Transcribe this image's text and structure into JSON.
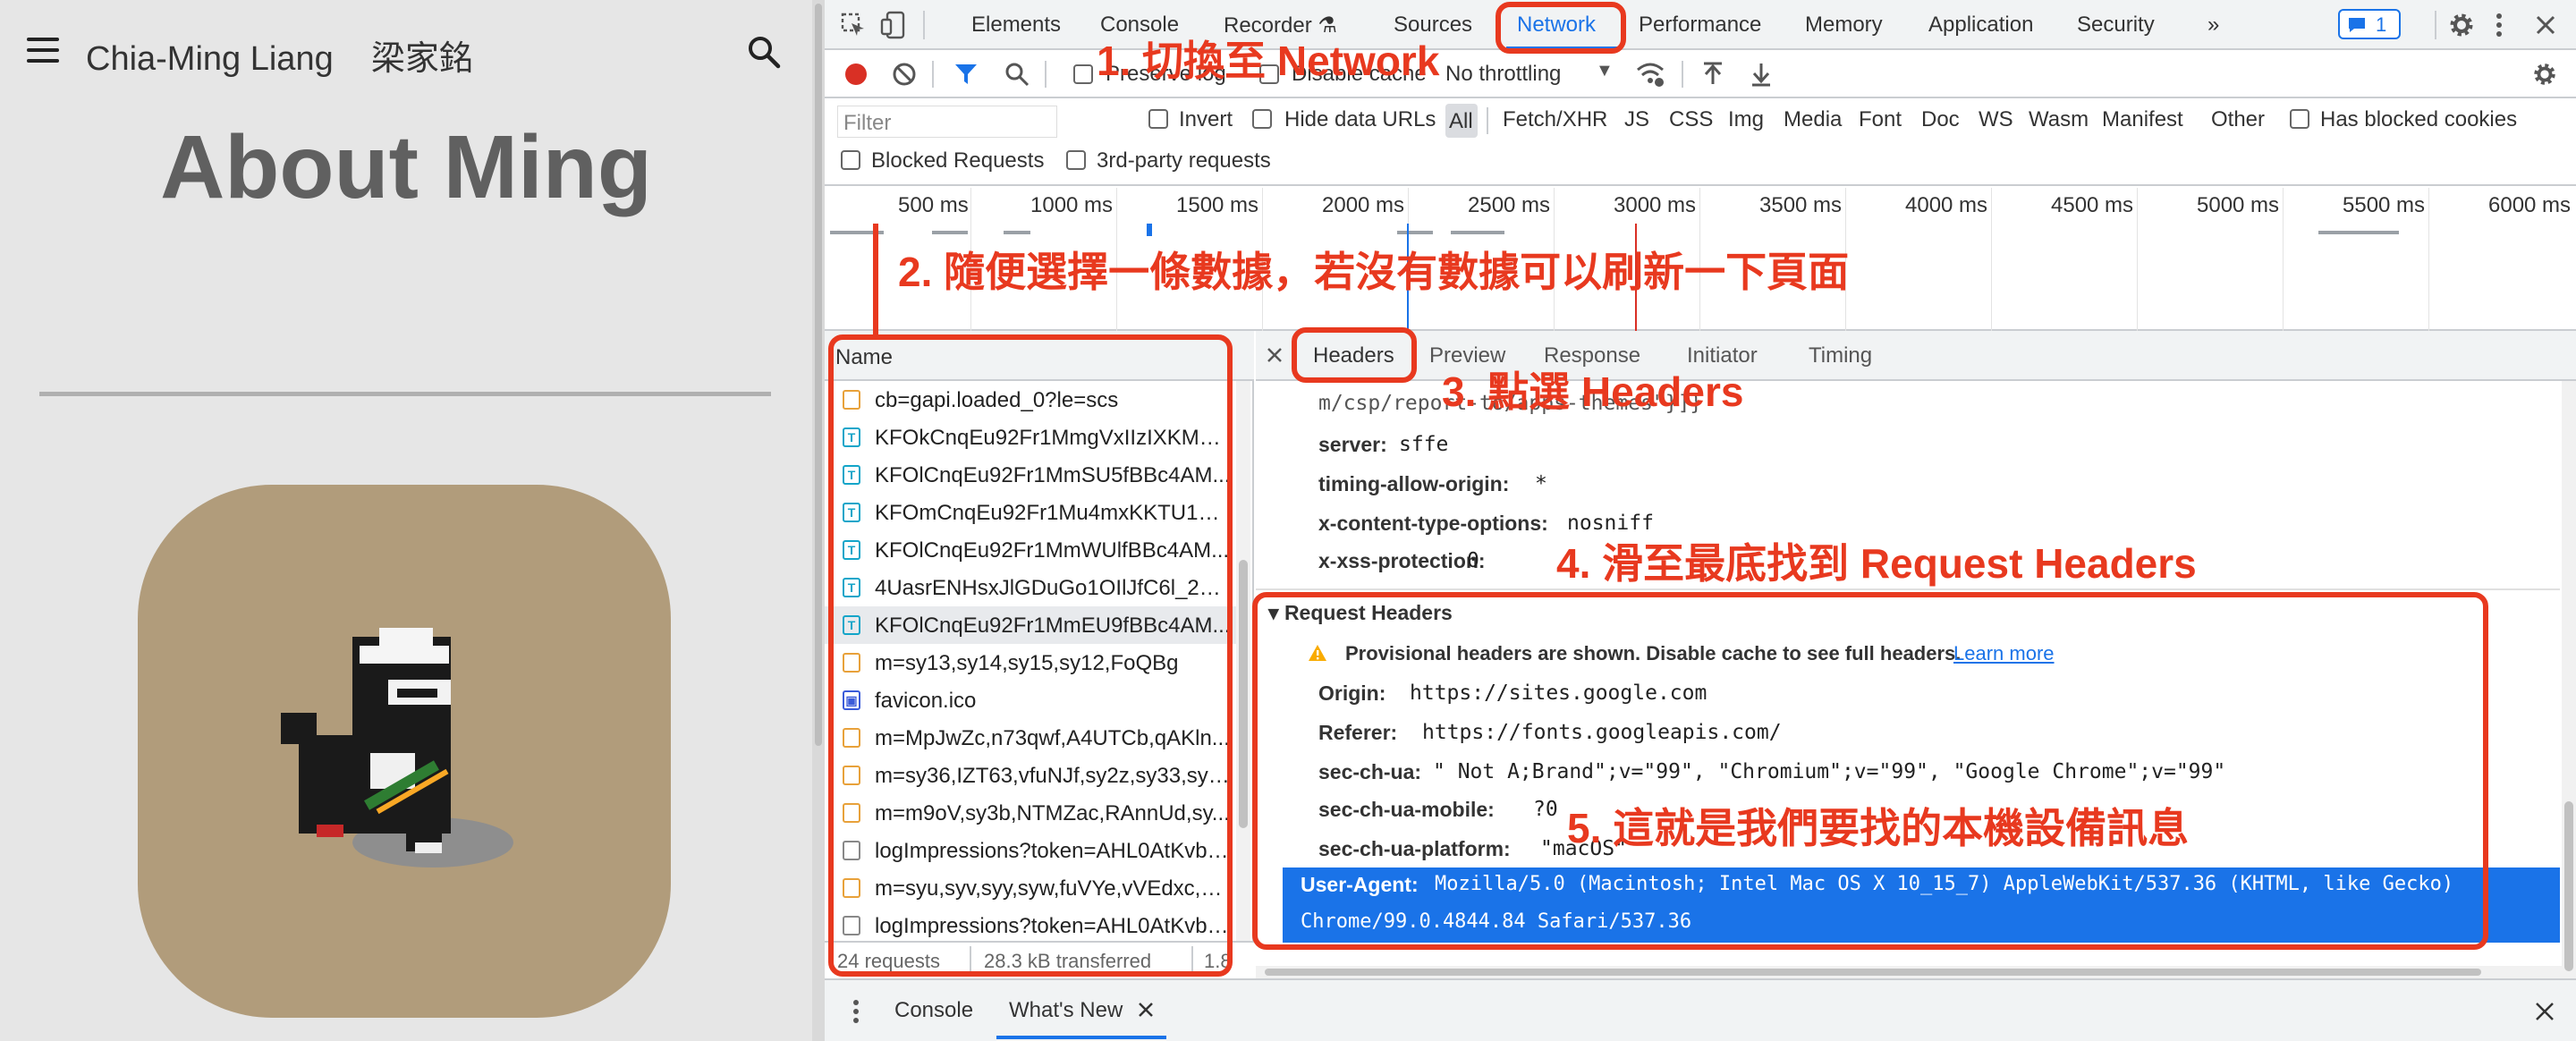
{
  "page": {
    "site_title": "Chia-Ming Liang    梁家銘",
    "heading": "About Ming"
  },
  "devtools": {
    "tabs": [
      "Elements",
      "Console",
      "Recorder ⚗",
      "Sources",
      "Network",
      "Performance",
      "Memory",
      "Application",
      "Security",
      "»"
    ],
    "issues_badge": "1",
    "toolbar": {
      "preserve_log": "Preserve log",
      "disable_cache": "Disable cache",
      "throttling": "No throttling"
    },
    "filter": {
      "placeholder": "Filter",
      "invert": "Invert",
      "hide_data_urls": "Hide data URLs",
      "types": [
        "All",
        "Fetch/XHR",
        "JS",
        "CSS",
        "Img",
        "Media",
        "Font",
        "Doc",
        "WS",
        "Wasm",
        "Manifest",
        "Other"
      ],
      "has_blocked_cookies": "Has blocked cookies",
      "blocked_requests": "Blocked Requests",
      "third_party": "3rd-party requests"
    },
    "timeline_ticks": [
      "500 ms",
      "1000 ms",
      "1500 ms",
      "2000 ms",
      "2500 ms",
      "3000 ms",
      "3500 ms",
      "4000 ms",
      "4500 ms",
      "5000 ms",
      "5500 ms",
      "6000 ms"
    ],
    "name_header": "Name",
    "requests": [
      {
        "name": "cb=gapi.loaded_0?le=scs",
        "type": "js"
      },
      {
        "name": "KFOkCnqEu92Fr1MmgVxIIzIXKMny...",
        "type": "font"
      },
      {
        "name": "KFOlCnqEu92Fr1MmSU5fBBc4AM...",
        "type": "font"
      },
      {
        "name": "KFOmCnqEu92Fr1Mu4mxKKTU1Kg...",
        "type": "font"
      },
      {
        "name": "KFOlCnqEu92Fr1MmWUlfBBc4AM...",
        "type": "font"
      },
      {
        "name": "4UasrENHsxJlGDuGo1OIlJfC6l_24rl...",
        "type": "font"
      },
      {
        "name": "KFOlCnqEu92Fr1MmEU9fBBc4AM...",
        "type": "font"
      },
      {
        "name": "m=sy13,sy14,sy15,sy12,FoQBg",
        "type": "js"
      },
      {
        "name": "favicon.ico",
        "type": "img"
      },
      {
        "name": "m=MpJwZc,n73qwf,A4UTCb,qAKln...",
        "type": "js"
      },
      {
        "name": "m=sy36,IZT63,vfuNJf,sy2z,sy33,sy3...",
        "type": "js"
      },
      {
        "name": "m=m9oV,sy3b,NTMZac,RAnnUd,sy...",
        "type": "js"
      },
      {
        "name": "logImpressions?token=AHL0AtKvbn...",
        "type": "other"
      },
      {
        "name": "m=syu,syv,syy,syw,fuVYe,vVEdxc,sy...",
        "type": "js"
      },
      {
        "name": "logImpressions?token=AHL0AtKvbn...",
        "type": "other"
      }
    ],
    "status": {
      "requests": "24 requests",
      "transferred": "28.3 kB transferred",
      "extra": "1.8"
    },
    "detail_tabs": [
      "Headers",
      "Preview",
      "Response",
      "Initiator",
      "Timing"
    ],
    "response_headers_tail": "m/csp/report-to/apps-themes\"}]}",
    "response_headers": [
      {
        "key": "server:",
        "value": "sffe"
      },
      {
        "key": "timing-allow-origin:",
        "value": "*"
      },
      {
        "key": "x-content-type-options:",
        "value": "nosniff"
      },
      {
        "key": "x-xss-protection:",
        "value": "0"
      }
    ],
    "request_headers_title": "Request Headers",
    "provisional_warning": "Provisional headers are shown. Disable cache to see full headers.",
    "learn_more": "Learn more",
    "request_headers": [
      {
        "key": "Origin:",
        "value": "https://sites.google.com"
      },
      {
        "key": "Referer:",
        "value": "https://fonts.googleapis.com/"
      },
      {
        "key": "sec-ch-ua:",
        "value": "\" Not A;Brand\";v=\"99\", \"Chromium\";v=\"99\", \"Google Chrome\";v=\"99\""
      },
      {
        "key": "sec-ch-ua-mobile:",
        "value": "?0"
      },
      {
        "key": "sec-ch-ua-platform:",
        "value": "\"macOS\""
      }
    ],
    "user_agent_key": "User-Agent:",
    "user_agent_line1": "Mozilla/5.0 (Macintosh; Intel Mac OS X 10_15_7) AppleWebKit/537.36 (KHTML, like Gecko)",
    "user_agent_line2": "Chrome/99.0.4844.84 Safari/537.36",
    "drawer_tabs": [
      "Console",
      "What's New"
    ]
  },
  "annotations": {
    "step1": "1. 切換至 Network",
    "step2": "2. 隨便選擇一條數據，若沒有數據可以刷新一下頁面",
    "step3": "3. 點選 Headers",
    "step4": "4. 滑至最底找到 Request Headers",
    "step5": "5. 這就是我們要找的本機設備訊息"
  },
  "colors": {
    "annotation": "#e8391f",
    "selected_row": "#1a73e8",
    "avatar_bg": "#b19c7b"
  }
}
